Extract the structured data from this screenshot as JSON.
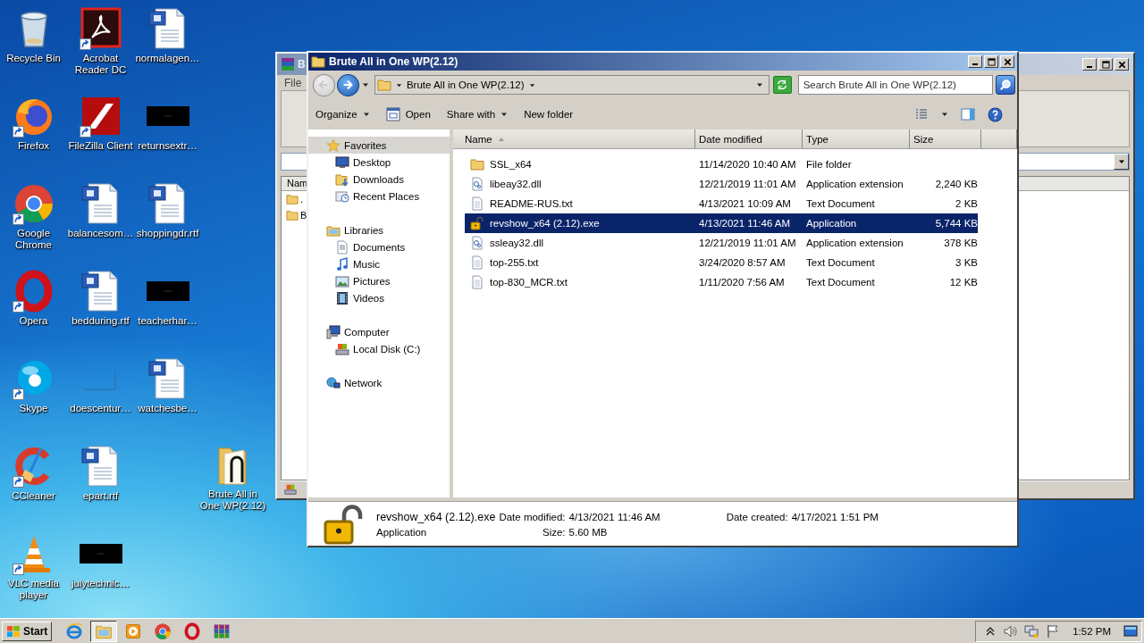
{
  "desktop": {
    "icon_rows": [
      {
        "icons": [
          {
            "label": "Recycle Bin",
            "kind": "recycle",
            "shortcut": false
          },
          {
            "label": "Acrobat Reader DC",
            "kind": "acrobat",
            "shortcut": true
          },
          {
            "label": "normalagen…",
            "kind": "word",
            "shortcut": false
          }
        ]
      },
      {
        "icons": [
          {
            "label": "Firefox",
            "kind": "firefox",
            "shortcut": true
          },
          {
            "label": "FileZilla Client",
            "kind": "filezilla",
            "shortcut": true
          },
          {
            "label": "returnsextr…",
            "kind": "black",
            "shortcut": false
          }
        ]
      },
      {
        "icons": [
          {
            "label": "Google Chrome",
            "kind": "chrome",
            "shortcut": true
          },
          {
            "label": "balancesom…",
            "kind": "word",
            "shortcut": false
          },
          {
            "label": "shoppingdr.rtf",
            "kind": "word",
            "shortcut": false
          }
        ]
      },
      {
        "icons": [
          {
            "label": "Opera",
            "kind": "opera",
            "shortcut": true
          },
          {
            "label": "bedduring.rtf",
            "kind": "word",
            "shortcut": false
          },
          {
            "label": "teacherhar…",
            "kind": "black",
            "shortcut": false
          }
        ]
      },
      {
        "icons": [
          {
            "label": "Skype",
            "kind": "skype",
            "shortcut": true
          },
          {
            "label": "doescentur…",
            "kind": "blank",
            "shortcut": false
          },
          {
            "label": "watchesbe…",
            "kind": "word",
            "shortcut": false
          }
        ]
      },
      {
        "icons": [
          {
            "label": "CCleaner",
            "kind": "ccleaner",
            "shortcut": true
          },
          {
            "label": "epart.rtf",
            "kind": "word",
            "shortcut": false
          }
        ]
      },
      {
        "icons": [
          {
            "label": "VLC media player",
            "kind": "vlc",
            "shortcut": true
          },
          {
            "label": "julytechnic…",
            "kind": "black",
            "shortcut": false
          }
        ]
      }
    ],
    "loose_icon": {
      "label": "Brute All in One WP(2.12)",
      "kind": "zipfolder",
      "shortcut": false
    }
  },
  "background_window": {
    "title": "B",
    "menu": [
      "File"
    ],
    "column": "Nam",
    "rows": [
      ".",
      "B"
    ]
  },
  "explorer": {
    "title": "Brute All in One WP(2.12)",
    "address": {
      "crumbs": [
        "Brute All in One WP(2.12)"
      ]
    },
    "search": {
      "placeholder": "Search Brute All in One WP(2.12)"
    },
    "toolbar": [
      {
        "label": "Organize",
        "kind": "menu"
      },
      {
        "label": "Open",
        "kind": "open"
      },
      {
        "label": "Share with",
        "kind": "menu"
      },
      {
        "label": "New folder",
        "kind": "plain"
      }
    ],
    "nav": [
      {
        "label": "Favorites",
        "kind": "star",
        "selected": true,
        "children": [
          {
            "label": "Desktop",
            "kind": "desktop",
            "selected": false
          },
          {
            "label": "Downloads",
            "kind": "downloads",
            "selected": false
          },
          {
            "label": "Recent Places",
            "kind": "recent",
            "selected": false
          }
        ]
      },
      {
        "label": "Libraries",
        "kind": "libraries",
        "selected": false,
        "children": [
          {
            "label": "Documents",
            "kind": "documents",
            "selected": false
          },
          {
            "label": "Music",
            "kind": "music",
            "selected": false
          },
          {
            "label": "Pictures",
            "kind": "pictures",
            "selected": false
          },
          {
            "label": "Videos",
            "kind": "videos",
            "selected": false
          }
        ]
      },
      {
        "label": "Computer",
        "kind": "computer",
        "selected": false,
        "children": [
          {
            "label": "Local Disk (C:)",
            "kind": "disk",
            "selected": false
          }
        ]
      },
      {
        "label": "Network",
        "kind": "network",
        "selected": false
      }
    ],
    "columns": [
      {
        "label": "Name",
        "sorted": true
      },
      {
        "label": "Date modified",
        "sorted": false
      },
      {
        "label": "Type",
        "sorted": false
      },
      {
        "label": "Size",
        "sorted": false
      }
    ],
    "files": [
      {
        "name": "SSL_x64",
        "date": "11/14/2020 10:40 AM",
        "type": "File folder",
        "kind": "folder",
        "selected": false
      },
      {
        "name": "libeay32.dll",
        "date": "12/21/2019 11:01 AM",
        "type": "Application extension",
        "size": "2,240 KB",
        "kind": "dll",
        "selected": false
      },
      {
        "name": "README-RUS.txt",
        "date": "4/13/2021 10:09 AM",
        "type": "Text Document",
        "size": "2 KB",
        "kind": "txt",
        "selected": false
      },
      {
        "name": "revshow_x64 (2.12).exe",
        "date": "4/13/2021 11:46 AM",
        "type": "Application",
        "size": "5,744 KB",
        "kind": "exe",
        "selected": true
      },
      {
        "name": "ssleay32.dll",
        "date": "12/21/2019 11:01 AM",
        "type": "Application extension",
        "size": "378 KB",
        "kind": "dll",
        "selected": false
      },
      {
        "name": "top-255.txt",
        "date": "3/24/2020 8:57 AM",
        "type": "Text Document",
        "size": "3 KB",
        "kind": "txt",
        "selected": false
      },
      {
        "name": "top-830_MCR.txt",
        "date": "1/11/2020 7:56 AM",
        "type": "Text Document",
        "size": "12 KB",
        "kind": "txt",
        "selected": false
      }
    ],
    "details": {
      "name": "revshow_x64 (2.12).exe",
      "type": "Application",
      "kind": "exe",
      "fields": [
        {
          "label": "Date modified:",
          "value": "4/13/2021 11:46 AM"
        },
        {
          "label": "Size:",
          "value": "5.60 MB"
        },
        {
          "label": "Date created:",
          "value": "4/17/2021 1:51 PM"
        }
      ]
    }
  },
  "taskbar": {
    "start": "Start",
    "apps": [
      {
        "kind": "ie",
        "active": false
      },
      {
        "kind": "explorer",
        "active": true
      },
      {
        "kind": "media",
        "active": false
      },
      {
        "kind": "chrome",
        "active": false
      },
      {
        "kind": "opera",
        "active": false
      },
      {
        "kind": "winrar",
        "active": false
      }
    ],
    "tray": {
      "time": "1:52 PM"
    }
  }
}
